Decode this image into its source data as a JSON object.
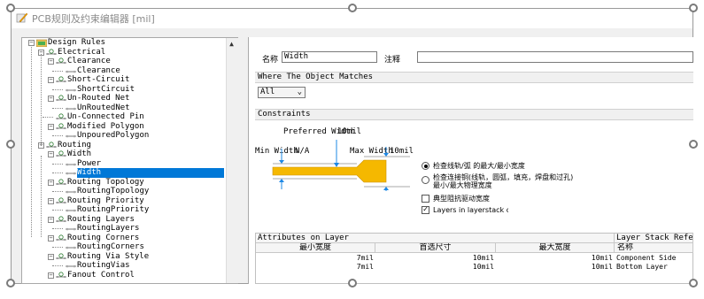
{
  "window": {
    "title": "PCB规则及约束编辑器 [mil]"
  },
  "tree": {
    "nodes": [
      {
        "label": "Design Rules",
        "selected": false
      },
      {
        "label": "Electrical",
        "selected": false
      },
      {
        "label": "Clearance",
        "selected": false
      },
      {
        "label": "Clearance",
        "selected": false
      },
      {
        "label": "Short-Circuit",
        "selected": false
      },
      {
        "label": "ShortCircuit",
        "selected": false
      },
      {
        "label": "Un-Routed Net",
        "selected": false
      },
      {
        "label": "UnRoutedNet",
        "selected": false
      },
      {
        "label": "Un-Connected Pin",
        "selected": false
      },
      {
        "label": "Modified Polygon",
        "selected": false
      },
      {
        "label": "UnpouredPolygon",
        "selected": false
      },
      {
        "label": "Routing",
        "selected": false
      },
      {
        "label": "Width",
        "selected": false
      },
      {
        "label": "Power",
        "selected": false
      },
      {
        "label": "Width",
        "selected": true
      },
      {
        "label": "Routing Topology",
        "selected": false
      },
      {
        "label": "RoutingTopology",
        "selected": false
      },
      {
        "label": "Routing Priority",
        "selected": false
      },
      {
        "label": "RoutingPriority",
        "selected": false
      },
      {
        "label": "Routing Layers",
        "selected": false
      },
      {
        "label": "RoutingLayers",
        "selected": false
      },
      {
        "label": "Routing Corners",
        "selected": false
      },
      {
        "label": "RoutingCorners",
        "selected": false
      },
      {
        "label": "Routing Via Style",
        "selected": false
      },
      {
        "label": "RoutingVias",
        "selected": false
      },
      {
        "label": "Fanout Control",
        "selected": false
      }
    ]
  },
  "rule": {
    "name_label": "名称",
    "name_value": "Width",
    "comment_label": "注释",
    "comment_value": ""
  },
  "where": {
    "header": "Where The Object Matches",
    "selected": "All"
  },
  "constraints": {
    "header": "Constraints",
    "preferred_label": "Preferred Width",
    "preferred_value": "10mil",
    "min_label": "Min Width",
    "min_value": "N/A",
    "max_label": "Max Width",
    "max_value": "10mil",
    "option1": "检查线轨/弧 的最大/最小宽度",
    "option2_line1": "检查连接铜(线轨，圆弧，填充，焊盘和过孔)",
    "option2_line2": "最小/最大物理宽度",
    "check1": "典型阻抗驱动宽度",
    "check2": "Layers in layerstack only",
    "check2_checked": true,
    "radio_selected": 1
  },
  "attributes": {
    "title": "Attributes on Layer",
    "stack_title": "Layer Stack Reference",
    "columns": [
      "最小宽度",
      "首选尺寸",
      "最大宽度",
      "名称"
    ],
    "rows": [
      {
        "min": "7mil",
        "pref": "10mil",
        "max": "10mil",
        "name": "Component Side"
      },
      {
        "min": "7mil",
        "pref": "10mil",
        "max": "10mil",
        "name": "Bottom Layer"
      }
    ]
  },
  "colors": {
    "trace": "#f5b800",
    "selection": "#0078d7",
    "arrow": "#1e88e5"
  }
}
